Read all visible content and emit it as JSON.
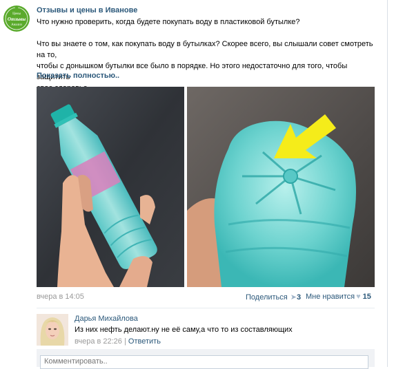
{
  "group": {
    "name": "Отзывы и цены в Иванове",
    "logo_text": [
      "Цены",
      "Отзывы",
      "Анализ"
    ]
  },
  "post": {
    "lines": [
      "Что нужно проверить, когда будете покупать воду в пластиковой бутылке?",
      "",
      "Что вы знаете о том, как покупать воду в бутылках? Скорее всего, вы слышали совет смотреть на то,",
      "чтобы с донышком бутылки все было в порядке. Но этого недостаточно для того, чтобы защитить",
      "свое здоровье."
    ],
    "show_more": "Показать полностью..",
    "date": "вчера в 14:05",
    "share_label": "Поделиться",
    "share_count": "3",
    "like_label": "Мне нравится",
    "like_count": "15"
  },
  "comment": {
    "author": "Дарья Михайлова",
    "text": "Из них нефть делают.ну не её саму,а что то из составляющих",
    "date": "вчера в 22:26",
    "separator": "|",
    "reply_label": "Ответить"
  },
  "compose": {
    "placeholder": "Комментировать.."
  },
  "colors": {
    "link": "#2b587a",
    "logo_green": "#5aaa2c",
    "water": "#7fd9d6",
    "arrow": "#f5ec1a"
  },
  "icons": {
    "share": "megaphone-icon",
    "like": "heart-icon"
  }
}
